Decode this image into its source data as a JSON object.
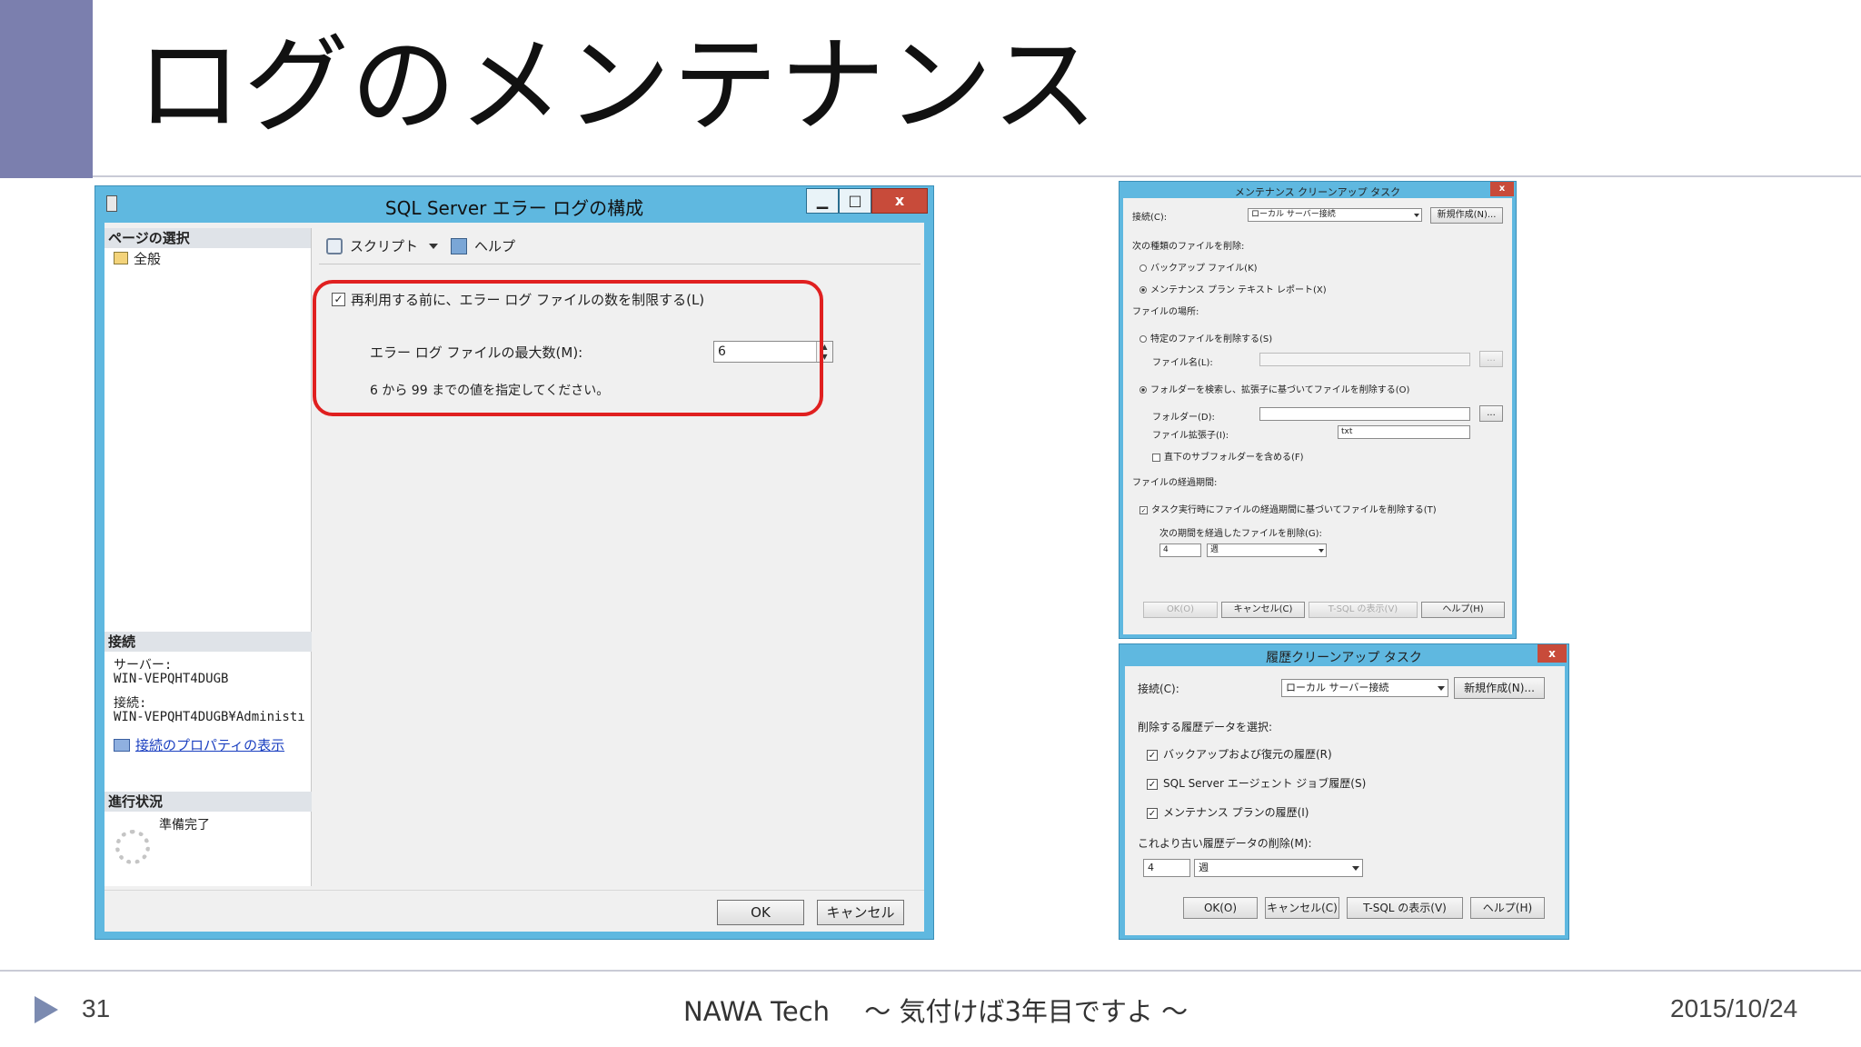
{
  "slide": {
    "title": "ログのメンテナンス",
    "page_number": "31",
    "footer_center": "NAWA Tech　 ～ 気付けば3年目ですよ ～",
    "footer_date": "2015/10/24"
  },
  "main_dialog": {
    "title": "SQL Server エラー ログの構成",
    "window_buttons": {
      "minimize": "▁",
      "maximize": "□",
      "close": "x"
    },
    "sidebar": {
      "page_select_header": "ページの選択",
      "page_items": [
        "全般"
      ],
      "connection_header": "接続",
      "server_label": "サーバー:",
      "server_value": "WIN-VEPQHT4DUGB",
      "connection_label": "接続:",
      "connection_value": "WIN-VEPQHT4DUGB¥Administı",
      "connection_props_link": "接続のプロパティの表示",
      "progress_header": "進行状況",
      "progress_status": "準備完了"
    },
    "toolbar": {
      "script": "スクリプト",
      "help": "ヘルプ"
    },
    "content": {
      "limit_checkbox_label": "再利用する前に、エラー ログ ファイルの数を制限する(L)",
      "limit_checked": true,
      "max_files_label": "エラー ログ ファイルの最大数(M):",
      "max_files_value": "6",
      "range_hint": "6 から 99 までの値を指定してください。"
    },
    "buttons": {
      "ok": "OK",
      "cancel": "キャンセル"
    }
  },
  "cleanup_dialog": {
    "title": "メンテナンス クリーンアップ タスク",
    "close": "x",
    "connection_label": "接続(C):",
    "connection_value": "ローカル サーバー接続",
    "new_button": "新規作成(N)...",
    "delete_type_header": "次の種類のファイルを削除:",
    "backup_files": "バックアップ ファイル(K)",
    "report_files": "メンテナンス プラン テキスト レポート(X)",
    "file_location_header": "ファイルの場所:",
    "specific_file": "特定のファイルを削除する(S)",
    "file_name_label": "ファイル名(L):",
    "browse": "...",
    "search_folder": "フォルダーを検索し、拡張子に基づいてファイルを削除する(O)",
    "folder_label": "フォルダー(D):",
    "extension_label": "ファイル拡張子(I):",
    "extension_value": "txt",
    "include_subfolders": "直下のサブフォルダーを含める(F)",
    "file_age_header": "ファイルの経過期間:",
    "delete_by_age": "タスク実行時にファイルの経過期間に基づいてファイルを削除する(T)",
    "older_than_label": "次の期間を経過したファイルを削除(G):",
    "age_value": "4",
    "age_unit": "週",
    "ok": "OK(O)",
    "cancel": "キャンセル(C)",
    "tsql": "T-SQL の表示(V)",
    "help": "ヘルプ(H)"
  },
  "history_dialog": {
    "title": "履歴クリーンアップ タスク",
    "close": "x",
    "connection_label": "接続(C):",
    "connection_value": "ローカル サーバー接続",
    "new_button": "新規作成(N)...",
    "select_header": "削除する履歴データを選択:",
    "backup_history": "バックアップおよび復元の履歴(R)",
    "agent_history": "SQL Server エージェント ジョブ履歴(S)",
    "plan_history": "メンテナンス プランの履歴(I)",
    "older_than_label": "これより古い履歴データの削除(M):",
    "age_value": "4",
    "age_unit": "週",
    "ok": "OK(O)",
    "cancel": "キャンセル(C)",
    "tsql": "T-SQL の表示(V)",
    "help": "ヘルプ(H)"
  }
}
